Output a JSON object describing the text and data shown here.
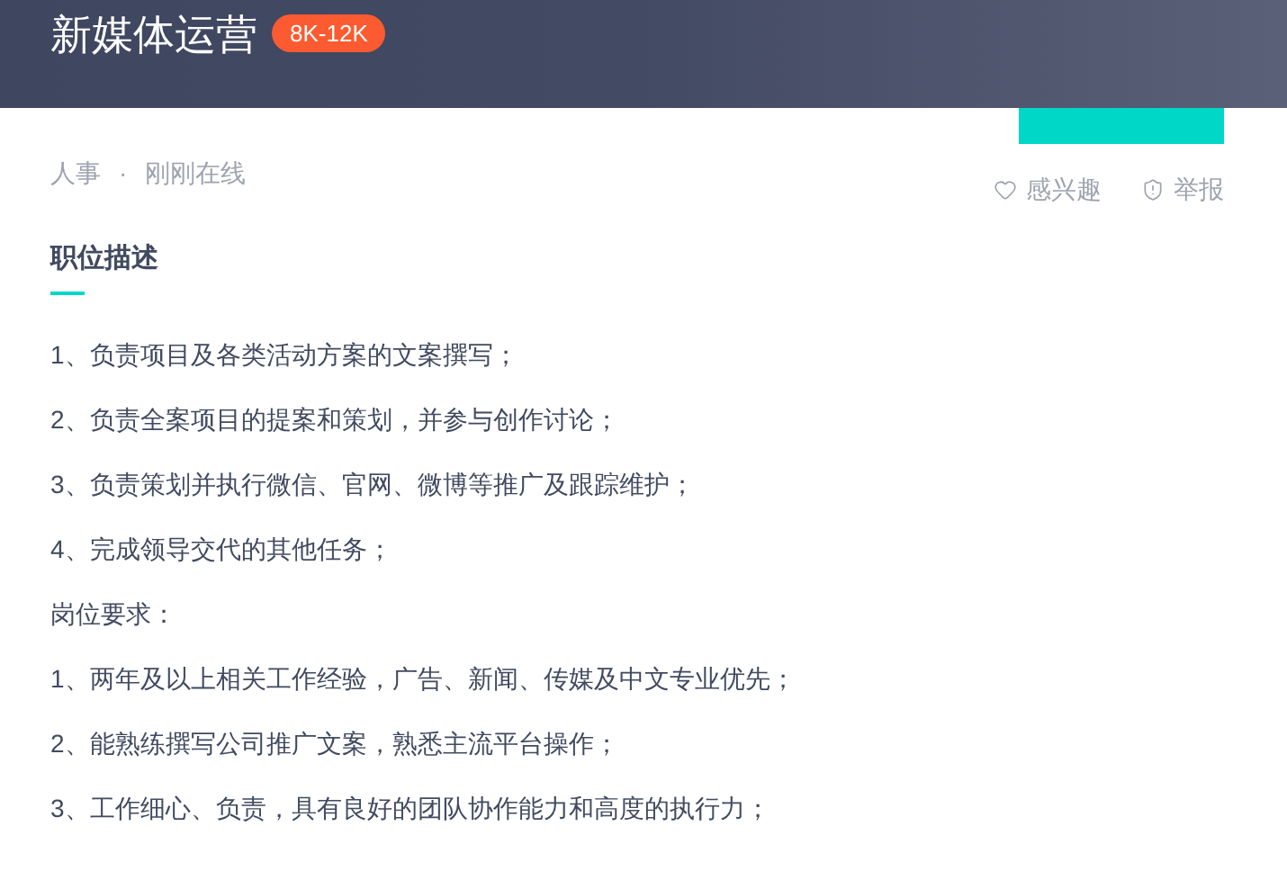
{
  "header": {
    "title": "新媒体运营",
    "salary": "8K-12K"
  },
  "recruiter": {
    "role": "人事",
    "separator": "·",
    "status": "刚刚在线"
  },
  "actions": [
    {
      "kind": "interest",
      "label": "感兴趣"
    },
    {
      "kind": "report",
      "label": "举报"
    }
  ],
  "section": {
    "title": "职位描述",
    "lines": [
      "1、负责项目及各类活动方案的文案撰写；",
      "2、负责全案项目的提案和策划，并参与创作讨论；",
      "3、负责策划并执行微信、官网、微博等推广及跟踪维护；",
      "4、完成领导交代的其他任务；",
      "岗位要求：",
      "1、两年及以上相关工作经验，广告、新闻、传媒及中文专业优先；",
      "2、能熟练撰写公司推广文案，熟悉主流平台操作；",
      "3、工作细心、负责，具有良好的团队协作能力和高度的执行力；"
    ]
  }
}
